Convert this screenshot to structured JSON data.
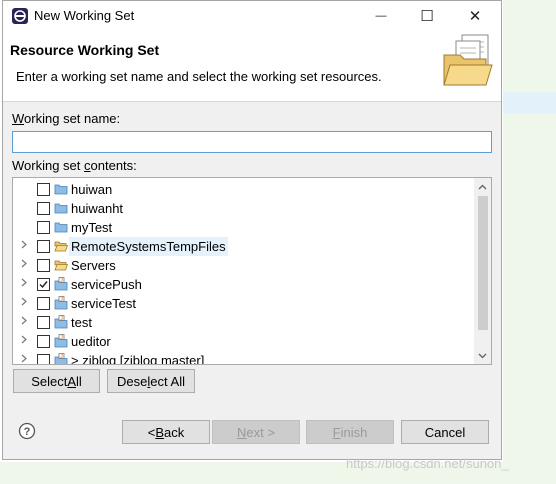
{
  "window": {
    "title": "New Working Set",
    "minimize": "—",
    "maximize": "☐",
    "close": "✕"
  },
  "header": {
    "title": "Resource Working Set",
    "description": "Enter a working set name and select the working set resources."
  },
  "form": {
    "name_label_accel": "W",
    "name_label_rest": "orking set name:",
    "name_value": "",
    "contents_label_pre": "Working set ",
    "contents_label_accel": "c",
    "contents_label_post": "ontents:"
  },
  "tree": {
    "items": [
      {
        "label": "huiwan",
        "checked": false,
        "expandable": false,
        "icon": "folder-icon"
      },
      {
        "label": "huiwanht",
        "checked": false,
        "expandable": false,
        "icon": "folder-icon"
      },
      {
        "label": "myTest",
        "checked": false,
        "expandable": false,
        "icon": "folder-icon"
      },
      {
        "label": "RemoteSystemsTempFiles",
        "checked": false,
        "expandable": true,
        "icon": "open-project-icon",
        "selected": true
      },
      {
        "label": "Servers",
        "checked": false,
        "expandable": true,
        "icon": "open-project-icon"
      },
      {
        "label": "servicePush",
        "checked": true,
        "expandable": true,
        "icon": "java-project-icon"
      },
      {
        "label": "serviceTest",
        "checked": false,
        "expandable": true,
        "icon": "java-project-icon"
      },
      {
        "label": "test",
        "checked": false,
        "expandable": true,
        "icon": "java-project-icon"
      },
      {
        "label": "ueditor",
        "checked": false,
        "expandable": true,
        "icon": "java-project-icon"
      },
      {
        "label": "> ziblog [ziblog master]",
        "checked": false,
        "expandable": true,
        "icon": "java-project-icon"
      }
    ]
  },
  "buttons": {
    "select_all_pre": "Select ",
    "select_all_accel": "A",
    "select_all_post": "ll",
    "deselect_all_pre": "Dese",
    "deselect_all_accel": "l",
    "deselect_all_post": "ect All",
    "back_pre": "< ",
    "back_accel": "B",
    "back_post": "ack",
    "next_accel": "N",
    "next_post": "ext >",
    "finish_accel": "F",
    "finish_post": "inish",
    "cancel": "Cancel"
  },
  "watermark": "https://blog.csdn.net/sunon_"
}
